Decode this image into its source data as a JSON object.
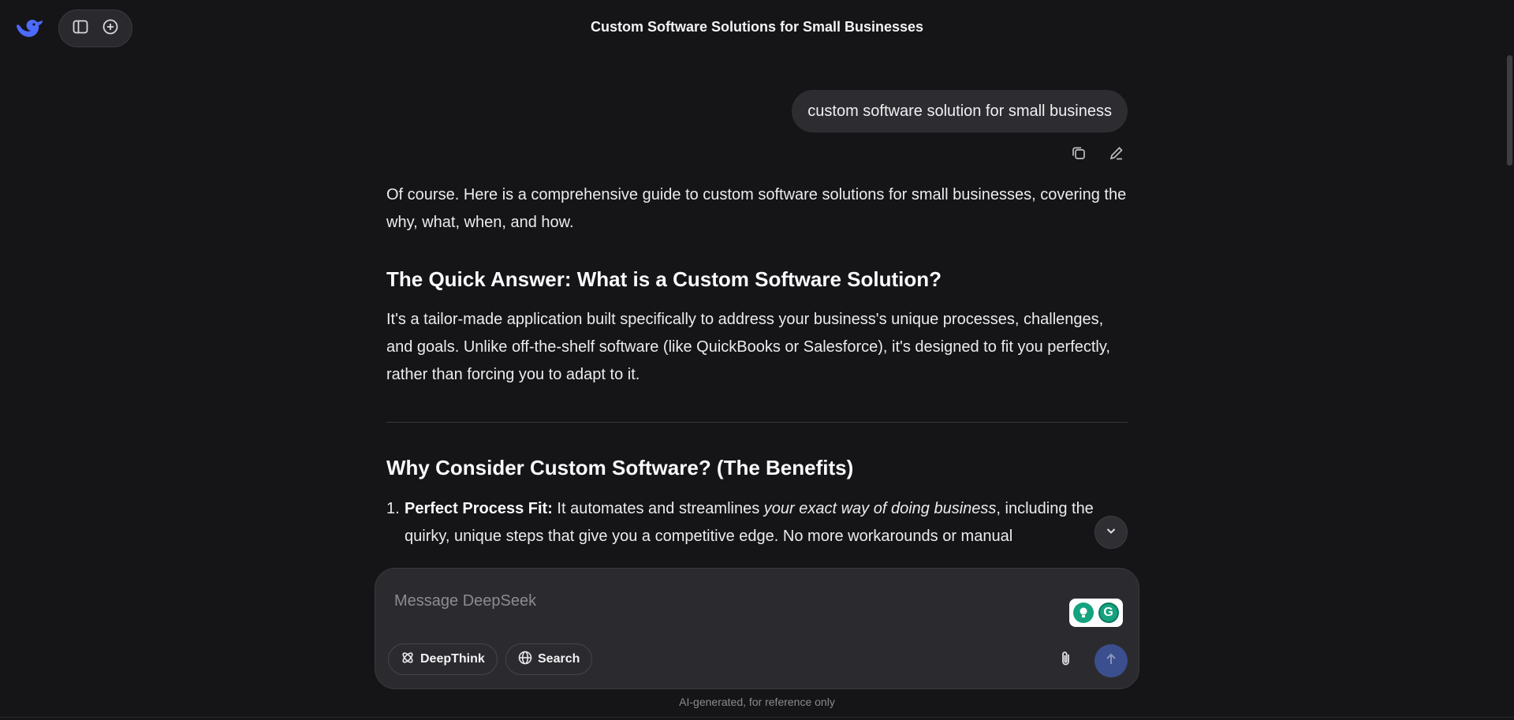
{
  "app": {
    "name": "DeepSeek",
    "accent_color": "#4d6bfe"
  },
  "header": {
    "title": "Custom Software Solutions for Small Businesses",
    "icons": [
      "deepseek-logo-icon",
      "sidebar-toggle-icon",
      "new-chat-icon"
    ]
  },
  "conversation": {
    "user_message": "custom software solution for small business",
    "message_action_icons": [
      "copy-icon",
      "edit-icon"
    ],
    "answer": {
      "intro": "Of course. Here is a comprehensive guide to custom software solutions for small businesses, covering the why, what, when, and how.",
      "section1_heading": "The Quick Answer: What is a Custom Software Solution?",
      "section1_body": "It's a tailor-made application built specifically to address your business's unique processes, challenges, and goals. Unlike off-the-shelf software (like QuickBooks or Salesforce), it's designed to fit you perfectly, rather than forcing you to adapt to it.",
      "section2_heading": "Why Consider Custom Software? (The Benefits)",
      "list": [
        {
          "number": "1.",
          "title": "Perfect Process Fit:",
          "text_before": " It automates and streamlines ",
          "emphasis": "your exact way of doing business",
          "text_after": ", including the quirky, unique steps that give you a competitive edge. No more workarounds or manual"
        }
      ]
    }
  },
  "composer": {
    "placeholder": "Message DeepSeek",
    "value": "",
    "deepthink_label": "DeepThink",
    "search_label": "Search",
    "icons": [
      "deepthink-icon",
      "globe-icon",
      "paperclip-icon",
      "send-arrow-icon",
      "grammarly-icon"
    ]
  },
  "footer": {
    "note": "AI-generated, for reference only"
  }
}
